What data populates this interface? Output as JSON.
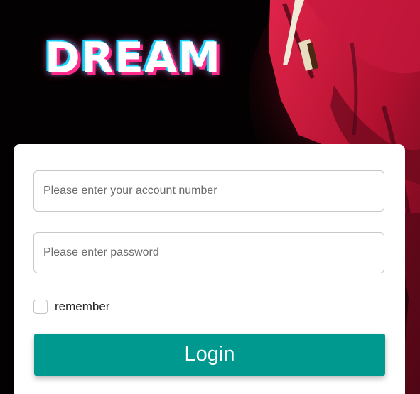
{
  "logo": {
    "text": "DREAM"
  },
  "login_form": {
    "account_placeholder": "Please enter your account number",
    "account_value": "",
    "password_placeholder": "Please enter password",
    "password_value": "",
    "remember_label": "remember",
    "remember_checked": false,
    "login_label": "Login"
  },
  "colors": {
    "background": "#000000",
    "logo_glow_cyan": "#18d4ff",
    "logo_glow_pink": "#ff2a8a",
    "hero_accent": "#c4163a",
    "login_button": "#009990",
    "card": "#ffffff"
  }
}
